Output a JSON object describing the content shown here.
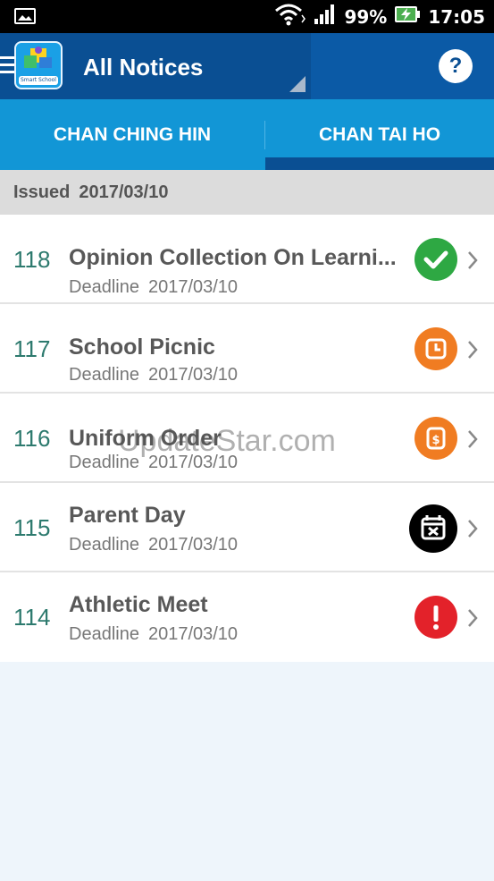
{
  "status_bar": {
    "battery": "99%",
    "time": "17:05",
    "icons": [
      "image-icon",
      "wifi-icon",
      "signal-icon",
      "battery-charging-icon"
    ]
  },
  "app_bar": {
    "title": "All Notices",
    "logo_text": "Smart School",
    "help_label": "?"
  },
  "tabs": [
    {
      "label": "CHAN CHING HIN",
      "selected": false
    },
    {
      "label": "CHAN TAI HO",
      "selected": true
    }
  ],
  "section": {
    "issued_label": "Issued",
    "issued_date": "2017/03/10"
  },
  "notices": [
    {
      "number": "118",
      "title": "Opinion  Collection On Learni...",
      "deadline_label": "Deadline",
      "deadline": "2017/03/10",
      "status_icon": "check-icon",
      "status_color": "#2ea843"
    },
    {
      "number": "117",
      "title": "School Picnic",
      "deadline_label": "Deadline",
      "deadline": "2017/03/10",
      "status_icon": "clock-icon",
      "status_color": "#f07c22"
    },
    {
      "number": "116",
      "title": "Uniform Order",
      "deadline_label": "Deadline",
      "deadline": "2017/03/10",
      "status_icon": "payment-icon",
      "status_color": "#f07c22"
    },
    {
      "number": "115",
      "title": "Parent Day",
      "deadline_label": "Deadline",
      "deadline": "2017/03/10",
      "status_icon": "calendar-cancel-icon",
      "status_color": "#000000"
    },
    {
      "number": "114",
      "title": "Athletic Meet",
      "deadline_label": "Deadline",
      "deadline": "2017/03/10",
      "status_icon": "alert-icon",
      "status_color": "#e3222a"
    }
  ],
  "watermark": "UpdateStar.com",
  "colors": {
    "app_bar": "#0a4f93",
    "tabs": "#1296d6",
    "notice_number": "#2d7a6e"
  }
}
